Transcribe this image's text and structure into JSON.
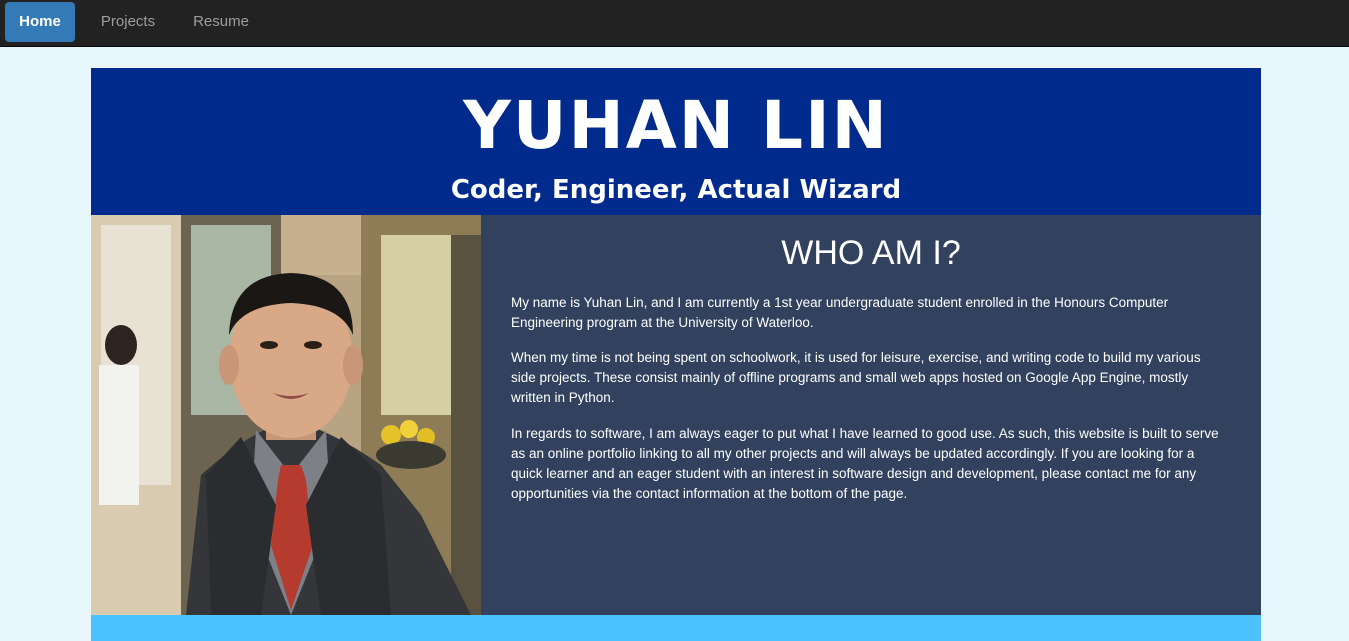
{
  "nav": {
    "items": [
      {
        "label": "Home",
        "active": true
      },
      {
        "label": "Projects",
        "active": false
      },
      {
        "label": "Resume",
        "active": false
      }
    ]
  },
  "header": {
    "name": "YUHAN LIN",
    "tagline": "Coder, Engineer, Actual Wizard"
  },
  "about": {
    "title": "WHO AM I?",
    "paragraphs": [
      "My name is Yuhan Lin, and I am currently a 1st year undergraduate student enrolled in the Honours Computer Engineering program at the University of Waterloo.",
      "When my time is not being spent on schoolwork, it is used for leisure, exercise, and writing code to build my various side projects. These consist mainly of offline programs and small web apps hosted on Google App Engine, mostly written in Python.",
      "In regards to software, I am always eager to put what I have learned to good use. As such, this website is built to serve as an online portfolio linking to all my other projects and will always be updated accordingly. If you are looking for a quick learner and an eager student with an interest in software design and development, please contact me for any opportunities via the contact information at the bottom of the page."
    ]
  },
  "colors": {
    "navbar": "#222222",
    "active_nav": "#337ab7",
    "header": "#002a8b",
    "about_panel": "#32425e",
    "bottom_band": "#4cc3ff",
    "page_bg": "#e8f6fd"
  }
}
